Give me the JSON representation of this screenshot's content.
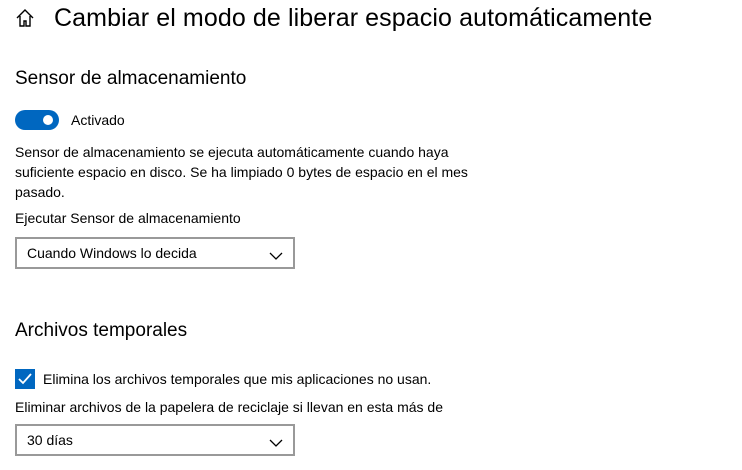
{
  "header": {
    "title": "Cambiar el modo de liberar espacio automáticamente"
  },
  "storage_sense": {
    "title": "Sensor de almacenamiento",
    "toggle_label": "Activado",
    "toggle_on": true,
    "description": "Sensor de almacenamiento se ejecuta automáticamente cuando haya suficiente espacio en disco. Se ha limpiado 0 bytes de espacio en el mes pasado.",
    "run_label": "Ejecutar Sensor de almacenamiento",
    "run_value": "Cuando Windows lo decida"
  },
  "temp_files": {
    "title": "Archivos temporales",
    "checkbox_label": "Elimina los archivos temporales que mis aplicaciones no usan.",
    "checkbox_checked": true,
    "recycle_label": "Eliminar archivos de la papelera de reciclaje si llevan en esta más de",
    "recycle_value": "30 días"
  },
  "colors": {
    "accent": "#0067c0",
    "dropdown_border": "#999999"
  },
  "icons": {
    "home": "home-icon",
    "chevron": "chevron-down-icon",
    "check": "check-icon"
  }
}
